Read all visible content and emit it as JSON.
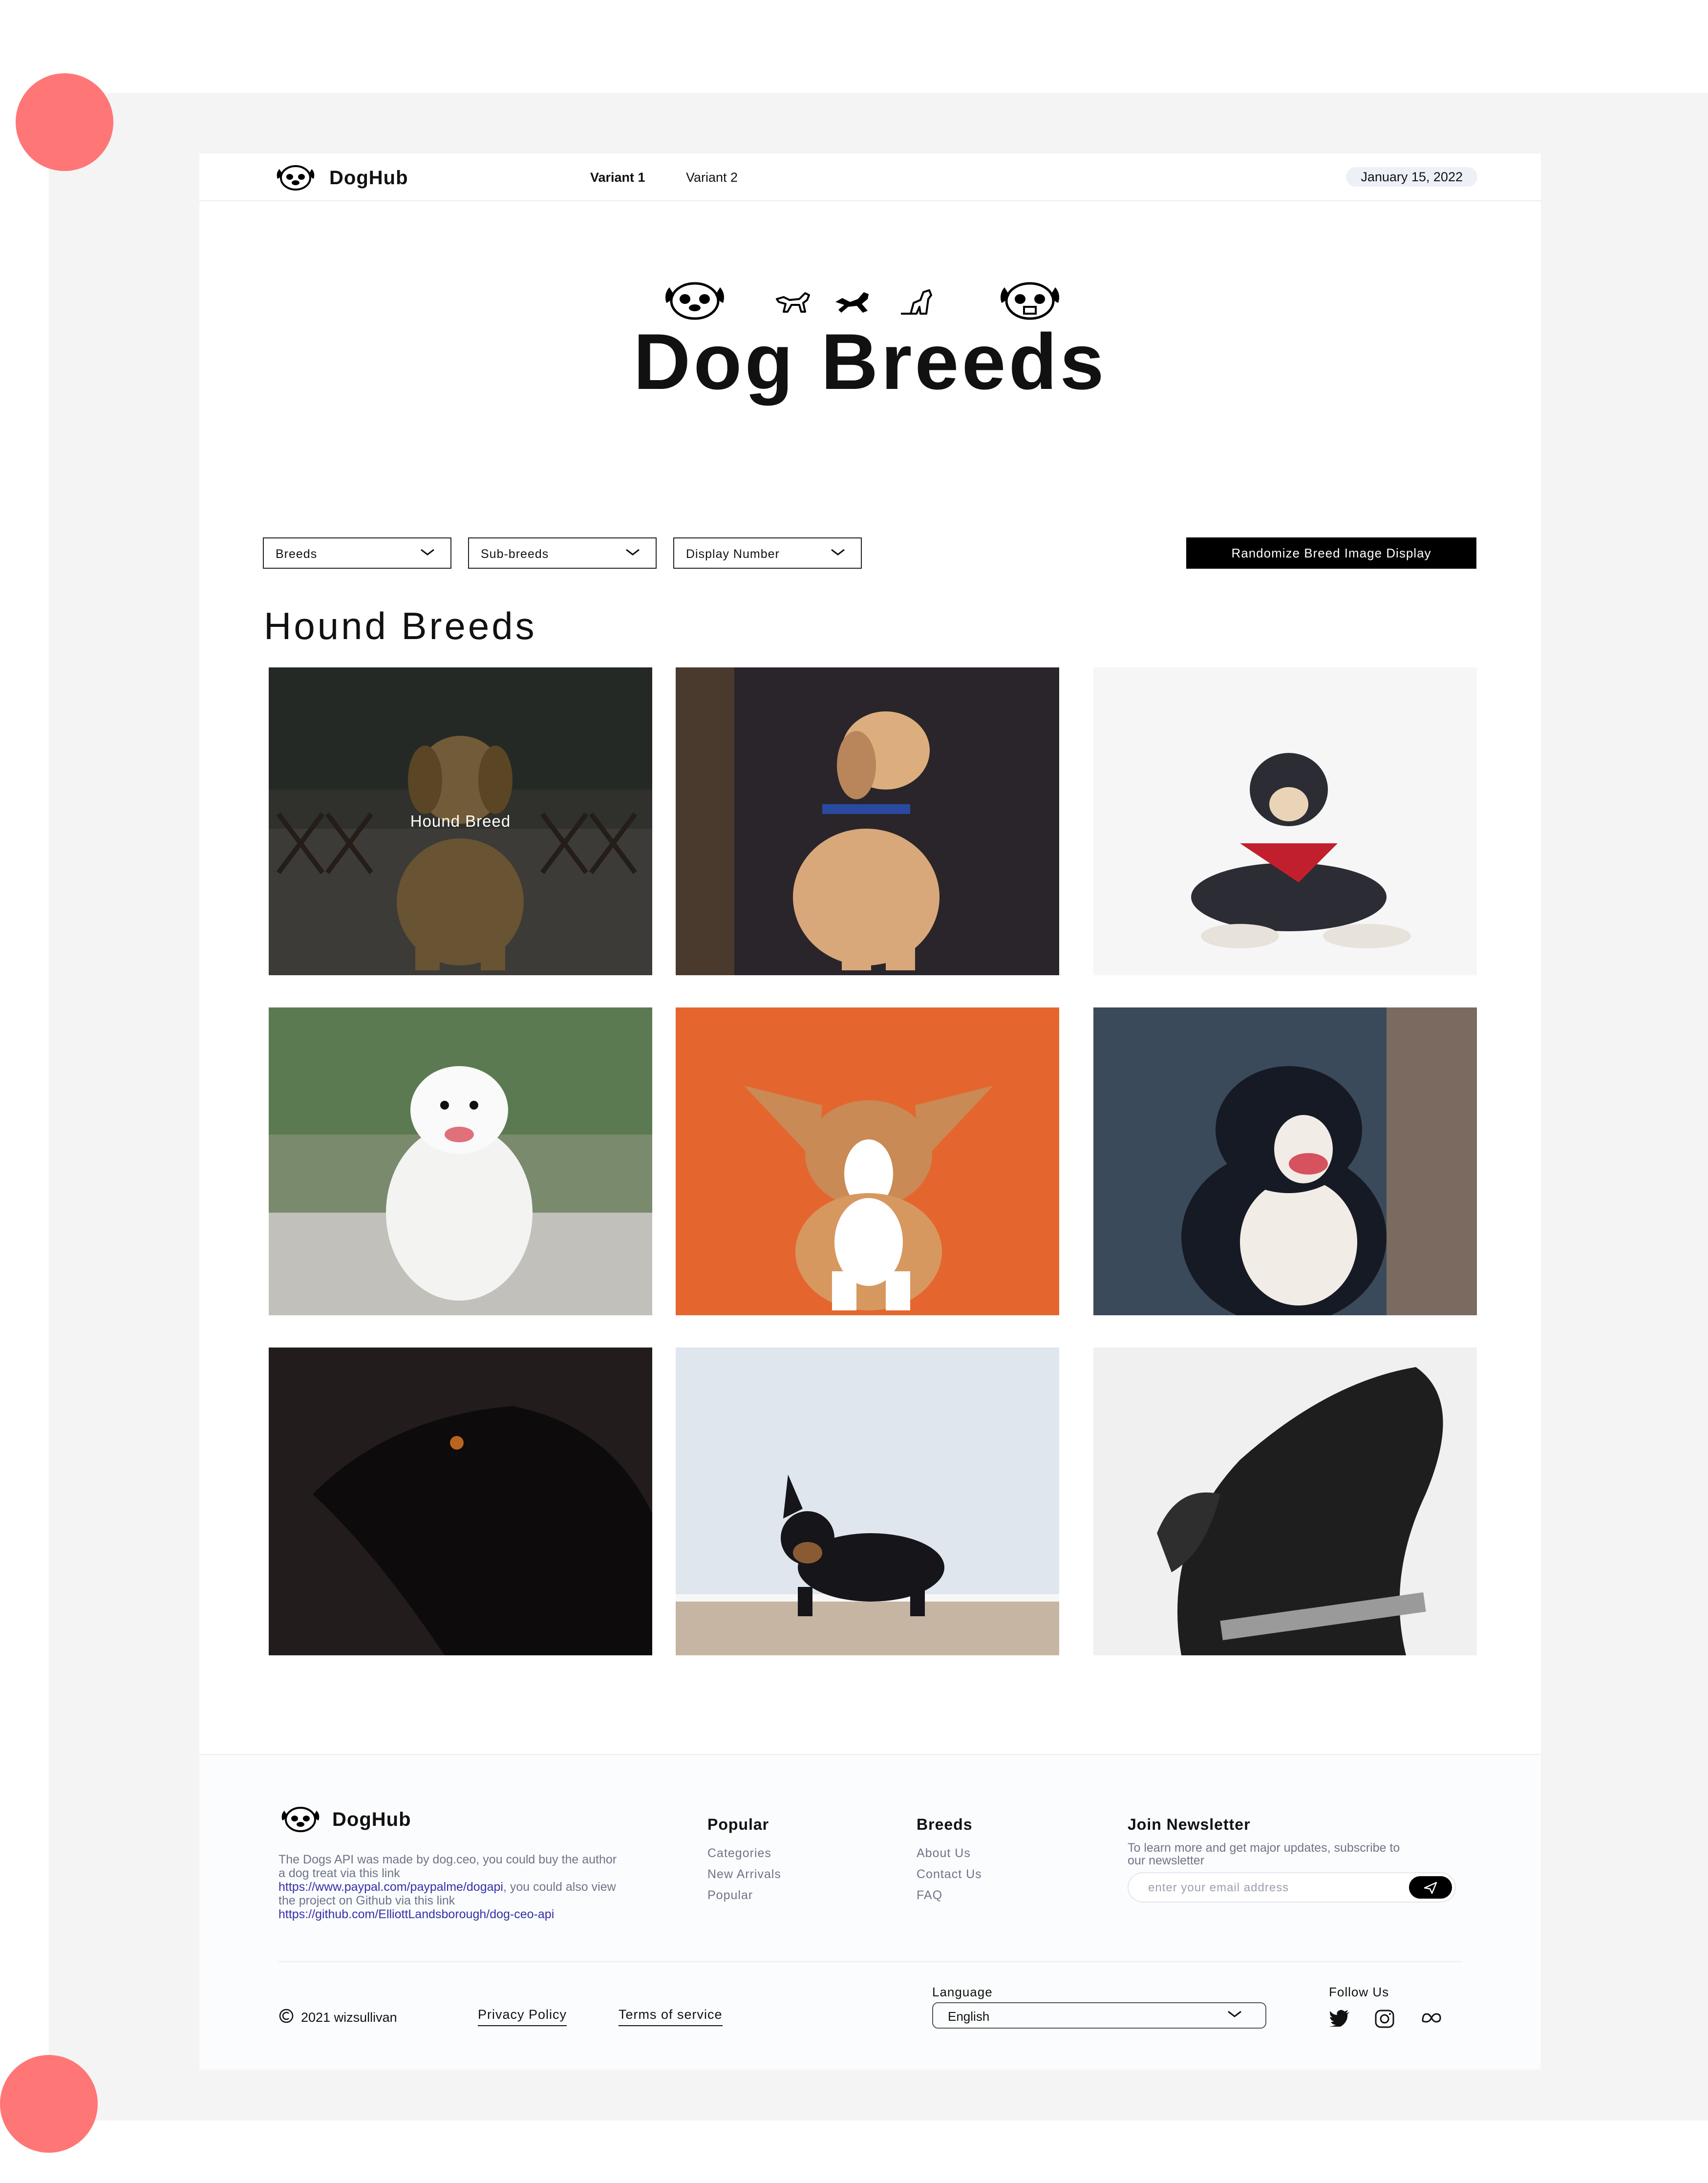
{
  "header": {
    "brand": "DogHub",
    "nav": [
      "Variant 1",
      "Variant 2"
    ],
    "date": "January 15, 2022"
  },
  "hero": {
    "title": "Dog Breeds"
  },
  "controls": {
    "breeds": "Breeds",
    "sub_breeds": "Sub-breeds",
    "display_number": "Display Number",
    "randomize": "Randomize Breed Image Display"
  },
  "section": {
    "title": "Hound Breeds"
  },
  "gallery": {
    "hover_caption": "Hound Breed"
  },
  "footer": {
    "brand": "DogHub",
    "about_text_1": "The Dogs API was made by dog.ceo, you could buy the author a dog treat via this link ",
    "about_link_1": "https://www.paypal.com/paypalme/dogapi",
    "about_text_2": ", you could also view the project on Github via this link ",
    "about_link_2": "https://github.com/ElliottLandsborough/dog-ceo-api",
    "popular": {
      "heading": "Popular",
      "links": [
        "Categories",
        "New Arrivals",
        "Popular"
      ]
    },
    "breeds": {
      "heading": "Breeds",
      "links": [
        "About Us",
        "Contact Us",
        "FAQ"
      ]
    },
    "newsletter": {
      "heading": "Join Newsletter",
      "text": "To learn more and get major updates, subscribe to our newsletter",
      "placeholder": "enter your email address"
    },
    "copyright": "2021 wizsullivan",
    "privacy": "Privacy Policy",
    "terms": "Terms of service",
    "language_label": "Language",
    "language_value": "English",
    "follow_label": "Follow Us"
  }
}
